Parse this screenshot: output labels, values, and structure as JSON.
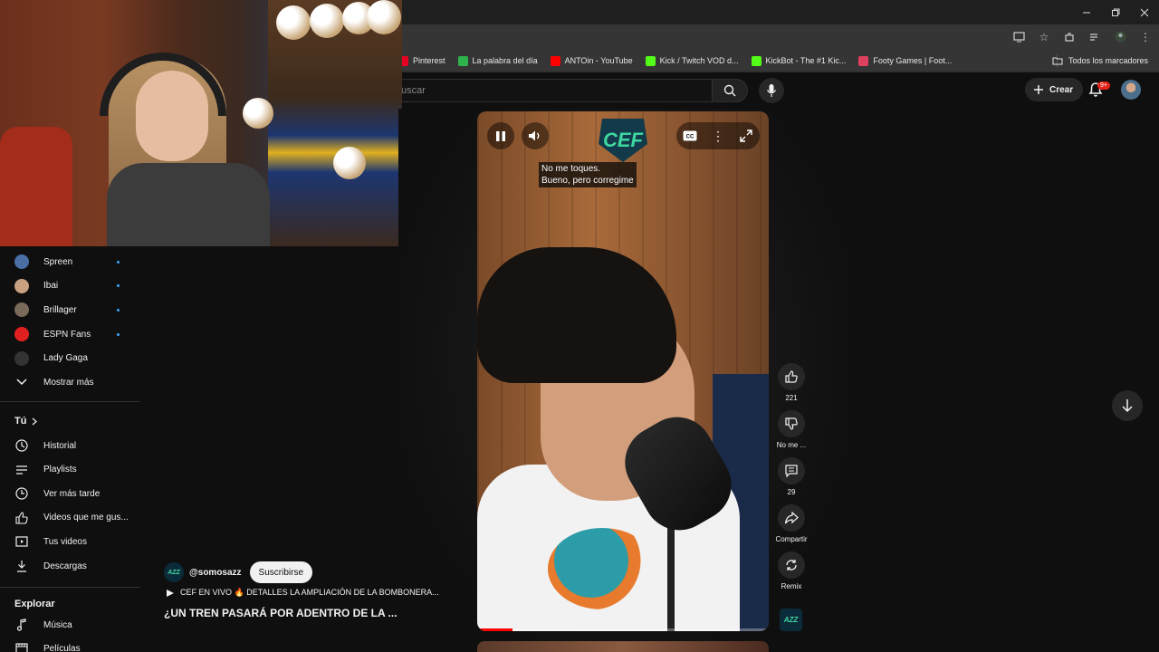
{
  "browser": {
    "bookmarks": [
      {
        "label": "Pinterest",
        "icon": "pinterest-icon",
        "color": "#e60023"
      },
      {
        "label": "La palabra del día",
        "icon": "palabra-icon",
        "color": "#2fb24c"
      },
      {
        "label": "ANTOin - YouTube",
        "icon": "youtube-icon",
        "color": "#ff0000"
      },
      {
        "label": "Kick / Twitch VOD d...",
        "icon": "kick-icon",
        "color": "#53fc18"
      },
      {
        "label": "KickBot - The #1 Kic...",
        "icon": "kickbot-icon",
        "color": "#53fc18"
      },
      {
        "label": "Footy Games | Foot...",
        "icon": "footy-icon",
        "color": "#e04060"
      }
    ],
    "all_bookmarks": "Todos los marcadores"
  },
  "header": {
    "search_placeholder": "uscar",
    "create_label": "Crear",
    "notif_badge": "9+"
  },
  "sidebar": {
    "subscriptions": [
      {
        "label": "Spreen",
        "has_dot": true,
        "color": "#4a6fa5"
      },
      {
        "label": "Ibai",
        "has_dot": true,
        "color": "#c9a080"
      },
      {
        "label": "Brillager",
        "has_dot": true,
        "color": "#7a6a5a"
      },
      {
        "label": "ESPN Fans",
        "has_dot": true,
        "color": "#e02020"
      },
      {
        "label": "Lady Gaga",
        "has_dot": false,
        "color": "#333333"
      }
    ],
    "show_more": "Mostrar más",
    "you_heading": "Tú",
    "you_items": [
      {
        "label": "Historial",
        "icon": "history-icon"
      },
      {
        "label": "Playlists",
        "icon": "playlists-icon"
      },
      {
        "label": "Ver más tarde",
        "icon": "watch-later-icon"
      },
      {
        "label": "Videos que me gus...",
        "icon": "liked-videos-icon"
      },
      {
        "label": "Tus videos",
        "icon": "your-videos-icon"
      },
      {
        "label": "Descargas",
        "icon": "downloads-icon"
      }
    ],
    "explore_heading": "Explorar",
    "explore_items": [
      {
        "label": "Música",
        "icon": "music-icon"
      },
      {
        "label": "Películas",
        "icon": "movies-icon"
      }
    ]
  },
  "short": {
    "logo_text": "CEF",
    "subtitle_line1": "No me toques.",
    "subtitle_line2": "Bueno, pero corregime",
    "progress": 0.12,
    "channel_handle": "@somosazz",
    "channel_badge": "AZZ",
    "subscribe_label": "Suscribirse",
    "live_text": "CEF EN VIVO 🔥 DETALLES LA AMPLIACIÓN DE LA BOMBONERA...",
    "title": "¿UN TREN PASARÁ POR ADENTRO DE LA ..."
  },
  "actions": {
    "like_count": "221",
    "dislike_label": "No me ...",
    "comments_count": "29",
    "share_label": "Compartir",
    "remix_label": "Remix"
  }
}
